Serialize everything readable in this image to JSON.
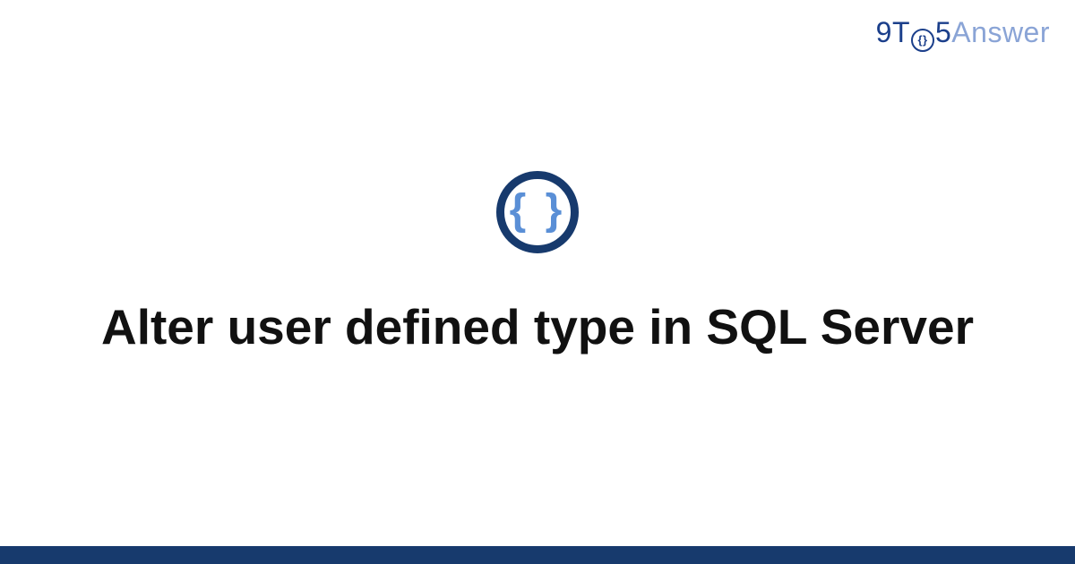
{
  "brand": {
    "part_9t": "9T",
    "circle_inner": "{}",
    "part_5": "5",
    "part_answer": "Answer"
  },
  "icon": {
    "glyph": "{ }"
  },
  "title": "Alter user defined type in SQL Server",
  "colors": {
    "brand_primary": "#1b3f8b",
    "brand_light": "#8aa4d6",
    "icon_ring": "#173a6d",
    "icon_braces": "#5a8fd6",
    "footer": "#173a6d"
  }
}
